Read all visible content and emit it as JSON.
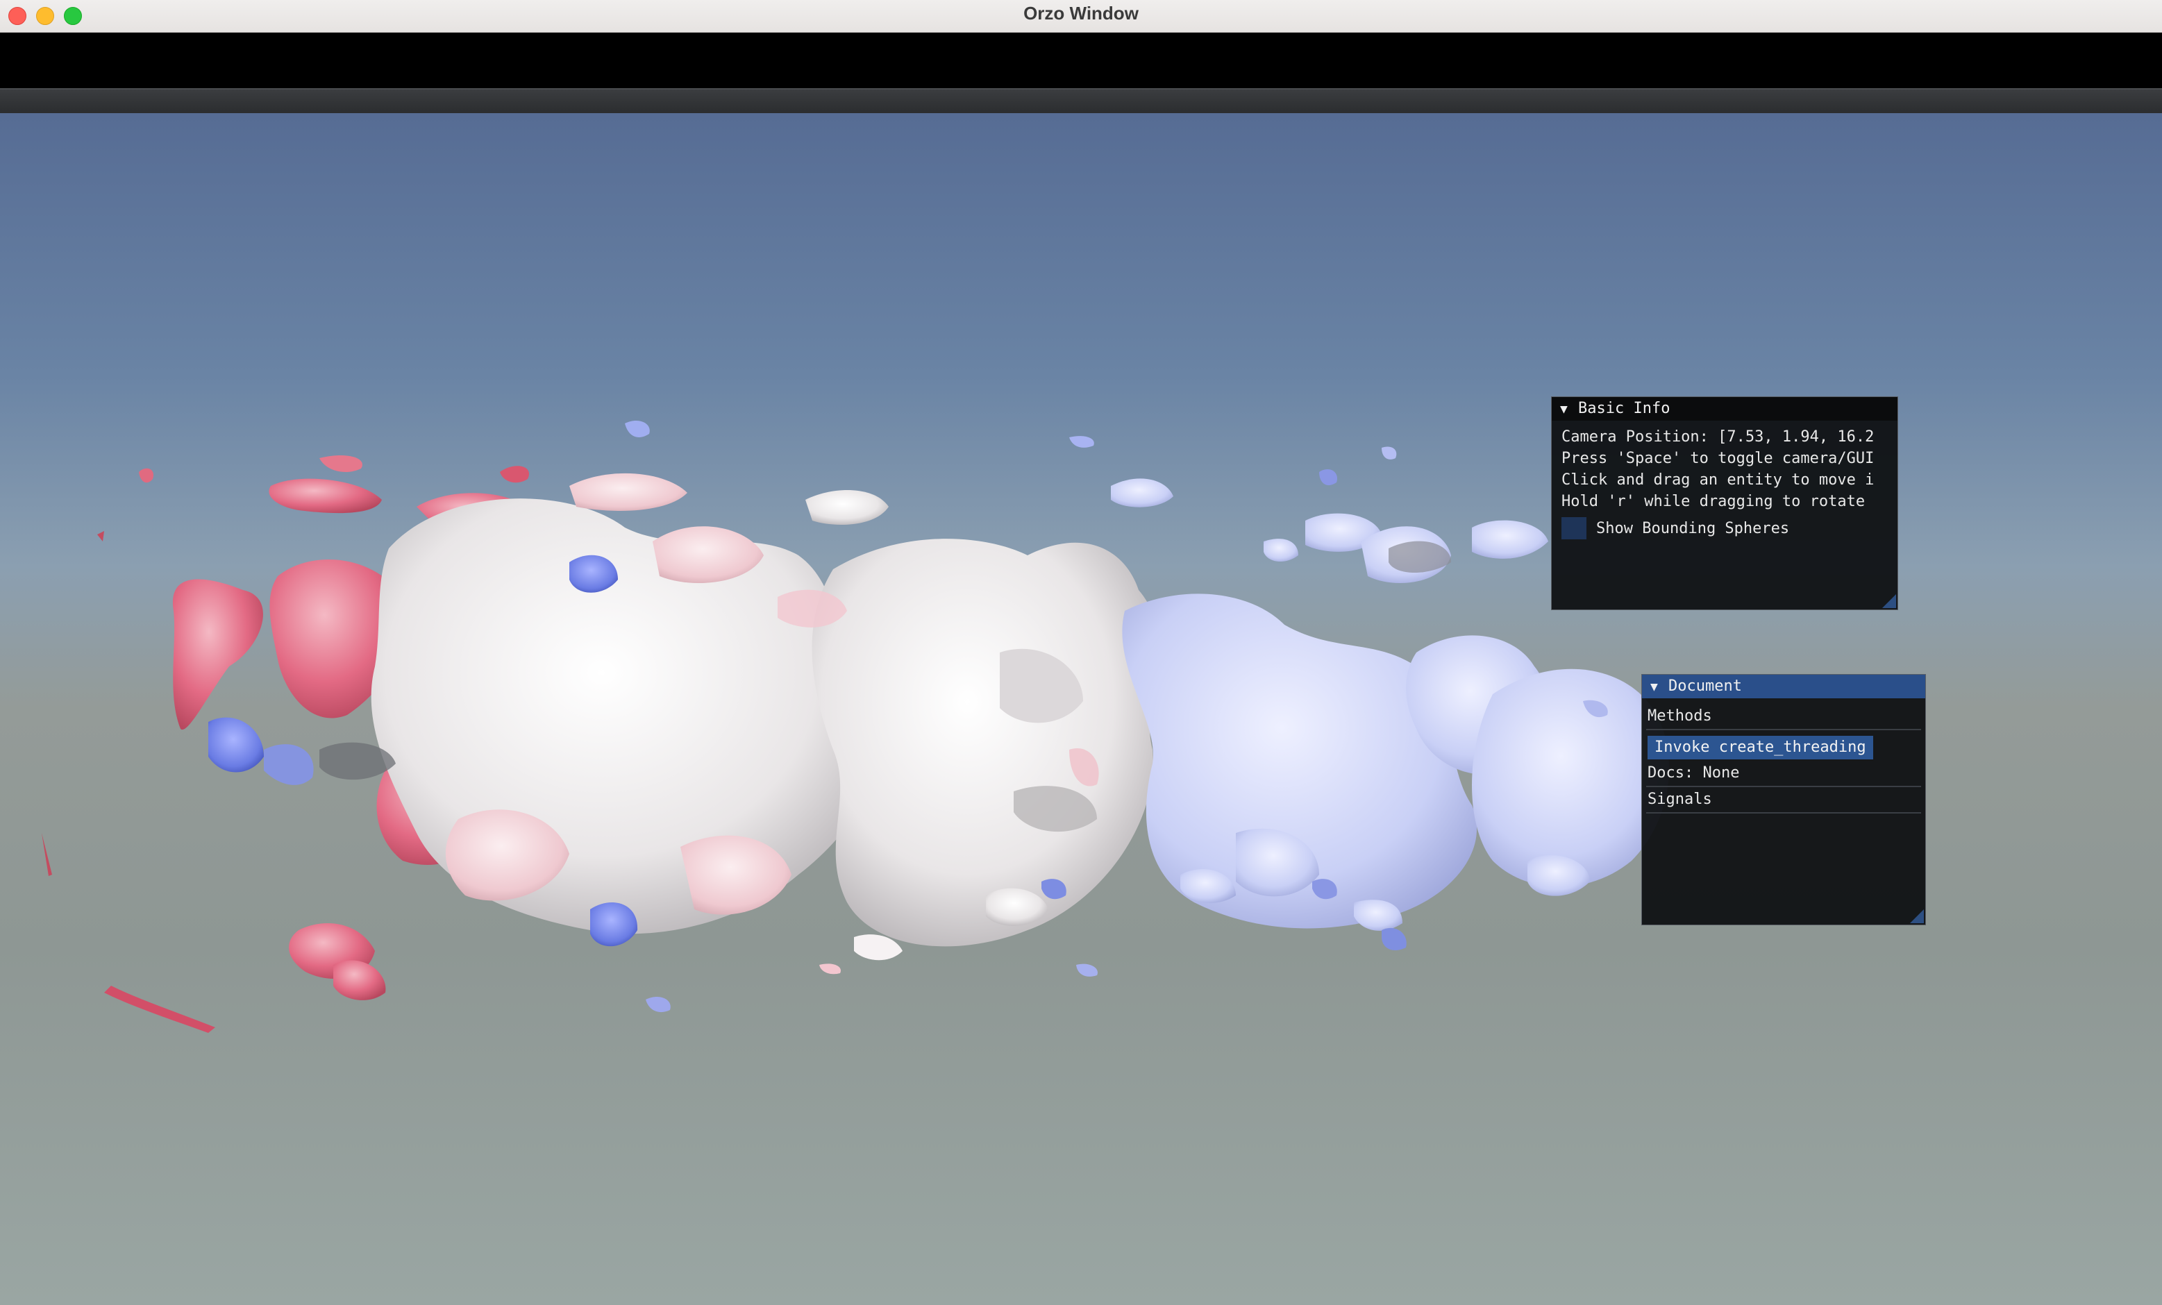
{
  "window": {
    "title": "Orzo Window"
  },
  "basic_info": {
    "title": "Basic Info",
    "lines": [
      "Camera Position: [7.53, 1.94, 16.2",
      "Press 'Space' to toggle camera/GUI",
      "Click and drag an entity to move i",
      "Hold 'r' while dragging to rotate"
    ],
    "checkbox_label": "Show Bounding Spheres",
    "checkbox_checked": false
  },
  "document": {
    "title": "Document",
    "methods_label": "Methods",
    "invoke_button": "Invoke create_threading",
    "docs": "Docs: None",
    "signals_label": "Signals"
  },
  "colors": {
    "sky_top": "#566c94",
    "ground": "#949b98",
    "imgui_bg": "#0e1012",
    "imgui_active_header": "#2a4f8a",
    "button": "#2c5591",
    "blob_red": "#e0607a",
    "blob_white": "#f2f0f0",
    "blob_blue": "#c8cff5"
  },
  "icons": {
    "collapse_arrow": "collapse-triangle-icon"
  }
}
